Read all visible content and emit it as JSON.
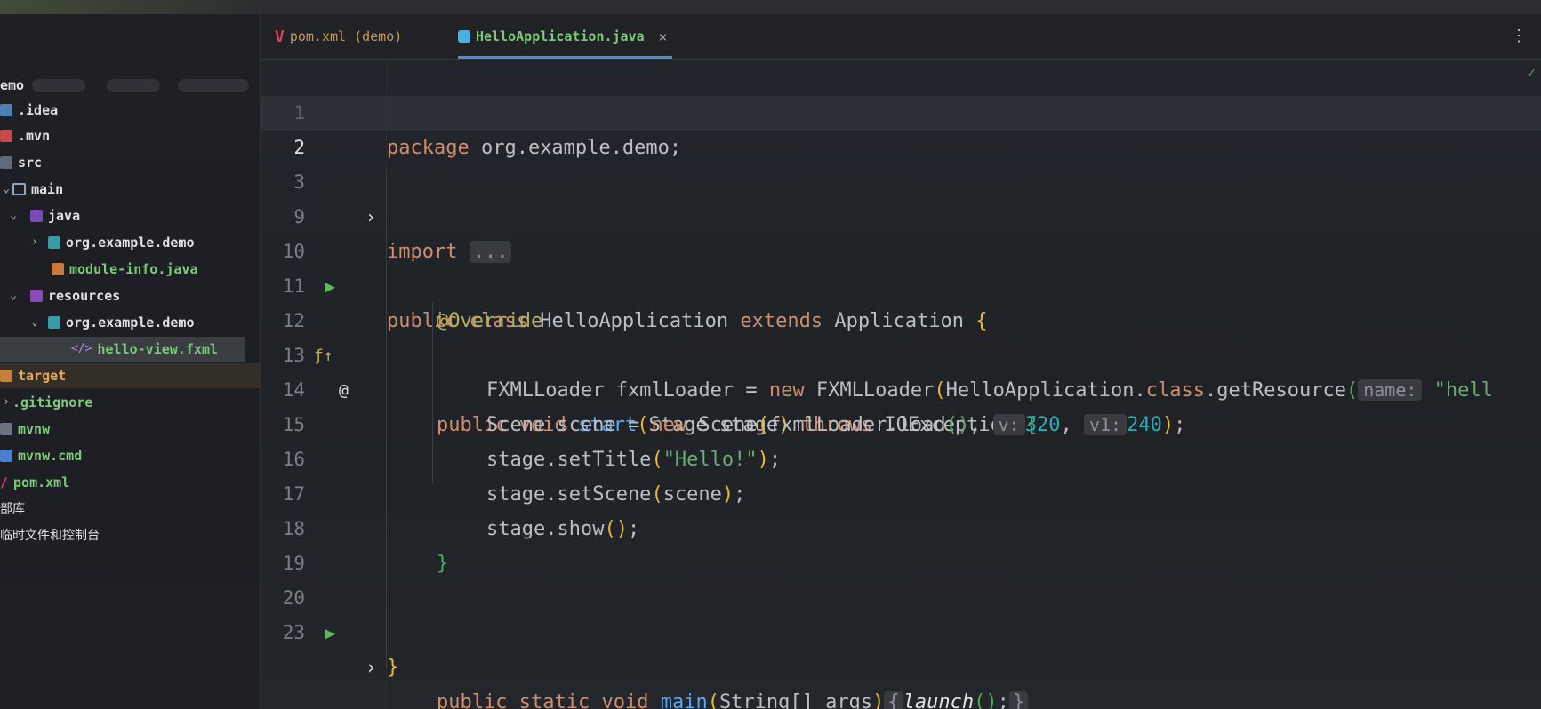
{
  "project": {
    "root": "emo",
    "items": [
      {
        "label": ".idea",
        "icon": "folder-icon"
      },
      {
        "label": ".mvn",
        "icon": "folder-icon"
      },
      {
        "label": "src",
        "icon": "folder-icon"
      },
      {
        "label": "main",
        "icon": "folder-icon"
      },
      {
        "label": "java",
        "icon": "source-folder-icon"
      },
      {
        "label": "org.example.demo",
        "icon": "package-icon"
      },
      {
        "label": "module-info.java",
        "icon": "java-file-icon"
      },
      {
        "label": "resources",
        "icon": "resources-folder-icon"
      },
      {
        "label": "org.example.demo",
        "icon": "package-icon"
      },
      {
        "label": "hello-view.fxml",
        "icon": "fxml-file-icon"
      },
      {
        "label": "target",
        "icon": "folder-icon"
      },
      {
        "label": ".gitignore",
        "icon": "gitignore-icon"
      },
      {
        "label": "mvnw",
        "icon": "file-icon"
      },
      {
        "label": "mvnw.cmd",
        "icon": "file-icon"
      },
      {
        "label": "pom.xml",
        "icon": "maven-icon"
      },
      {
        "label": "部库",
        "icon": "library-icon"
      },
      {
        "label": "临时文件和控制台",
        "icon": "scratch-icon"
      }
    ]
  },
  "tabs": [
    {
      "label": "pom.xml (demo)",
      "icon": "maven-icon"
    },
    {
      "label": "HelloApplication.java",
      "icon": "java-class-icon",
      "active": true
    }
  ],
  "editor": {
    "line_numbers": [
      "1",
      "2",
      "3",
      "9",
      "10",
      "11",
      "12",
      "13",
      "14",
      "15",
      "16",
      "17",
      "18",
      "19",
      "20",
      "23"
    ],
    "code": {
      "l1_kw": "package",
      "l1_rest": " org.example.demo;",
      "l3_kw": "import",
      "l3_fold": "...",
      "l10_public": "public",
      "l10_class": "class",
      "l10_name": " HelloApplication ",
      "l10_extends": "extends",
      "l10_parent": " Application ",
      "l10_brace": "{",
      "l11_ann": "@Override",
      "l12_public": "public",
      "l12_void": "void",
      "l12_fn": "start",
      "l12_params": "Stage stage",
      "l12_throws": "throws",
      "l12_exc": " IOException ",
      "l12_brace": "{",
      "l13_a": "FXMLLoader fxmlLoader = ",
      "l13_new": "new",
      "l13_b": " FXMLLoader",
      "l13_c": "HelloApplication.",
      "l13_class": "class",
      "l13_d": ".getResource",
      "l13_hint": "name:",
      "l13_str": "\"hell",
      "l14_a": "Scene scene = ",
      "l14_new": "new",
      "l14_b": " Scene",
      "l14_c": "fxmlLoader.load",
      "l14_hint1": "v:",
      "l14_num1": "320",
      "l14_hint2": "v1:",
      "l14_num2": "240",
      "l15_a": "stage.setTitle",
      "l15_str": "\"Hello!\"",
      "l16_a": "stage.setScene",
      "l16_b": "scene",
      "l17_a": "stage.show",
      "l18_brace": "}",
      "l20_public": "public",
      "l20_static": "static",
      "l20_void": "void",
      "l20_fn": "main",
      "l20_params": "String[] args",
      "l20_fold_open": "{",
      "l20_launch": "launch",
      "l20_fold_close": "}",
      "l23_brace": "}"
    }
  },
  "colors": {
    "keyword": "#cf8e6d",
    "function": "#56a8f5",
    "string": "#6aab73",
    "number": "#2aacb8",
    "annotation": "#b3ae60",
    "run": "#5fb85a",
    "tab_accent": "#4a89dc"
  }
}
